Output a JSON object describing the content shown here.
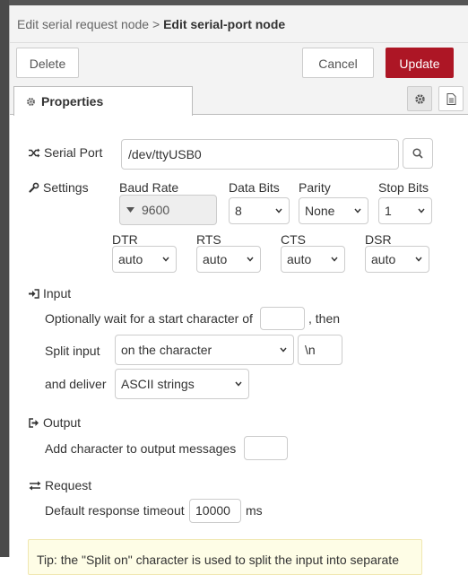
{
  "header": {
    "crumb": "Edit serial request node",
    "separator": ">",
    "title": "Edit serial-port node"
  },
  "toolbar": {
    "delete_label": "Delete",
    "cancel_label": "Cancel",
    "update_label": "Update"
  },
  "tabs": {
    "properties_label": "Properties"
  },
  "serial_port": {
    "label": "Serial Port",
    "value": "/dev/ttyUSB0"
  },
  "settings": {
    "label": "Settings",
    "baud_rate": {
      "label": "Baud Rate",
      "value": "9600"
    },
    "data_bits": {
      "label": "Data Bits",
      "value": "8"
    },
    "parity": {
      "label": "Parity",
      "value": "None"
    },
    "stop_bits": {
      "label": "Stop Bits",
      "value": "1"
    },
    "dtr": {
      "label": "DTR",
      "value": "auto"
    },
    "rts": {
      "label": "RTS",
      "value": "auto"
    },
    "cts": {
      "label": "CTS",
      "value": "auto"
    },
    "dsr": {
      "label": "DSR",
      "value": "auto"
    }
  },
  "input": {
    "label": "Input",
    "wait_label": "Optionally wait for a start character of",
    "wait_value": "",
    "then_label": ", then",
    "split_label": "Split input",
    "split_value": "on the character",
    "split_char": "\\n",
    "deliver_label": "and deliver",
    "deliver_value": "ASCII strings"
  },
  "output": {
    "label": "Output",
    "add_char_label": "Add character to output messages",
    "add_char_value": ""
  },
  "request": {
    "label": "Request",
    "timeout_label": "Default response timeout",
    "timeout_value": "10000",
    "timeout_unit": "ms"
  },
  "tip": {
    "text": "Tip: the \"Split on\" character is used to split the input into separate"
  },
  "colors": {
    "accent": "#ad1625",
    "tip_bg": "#fefde6"
  }
}
